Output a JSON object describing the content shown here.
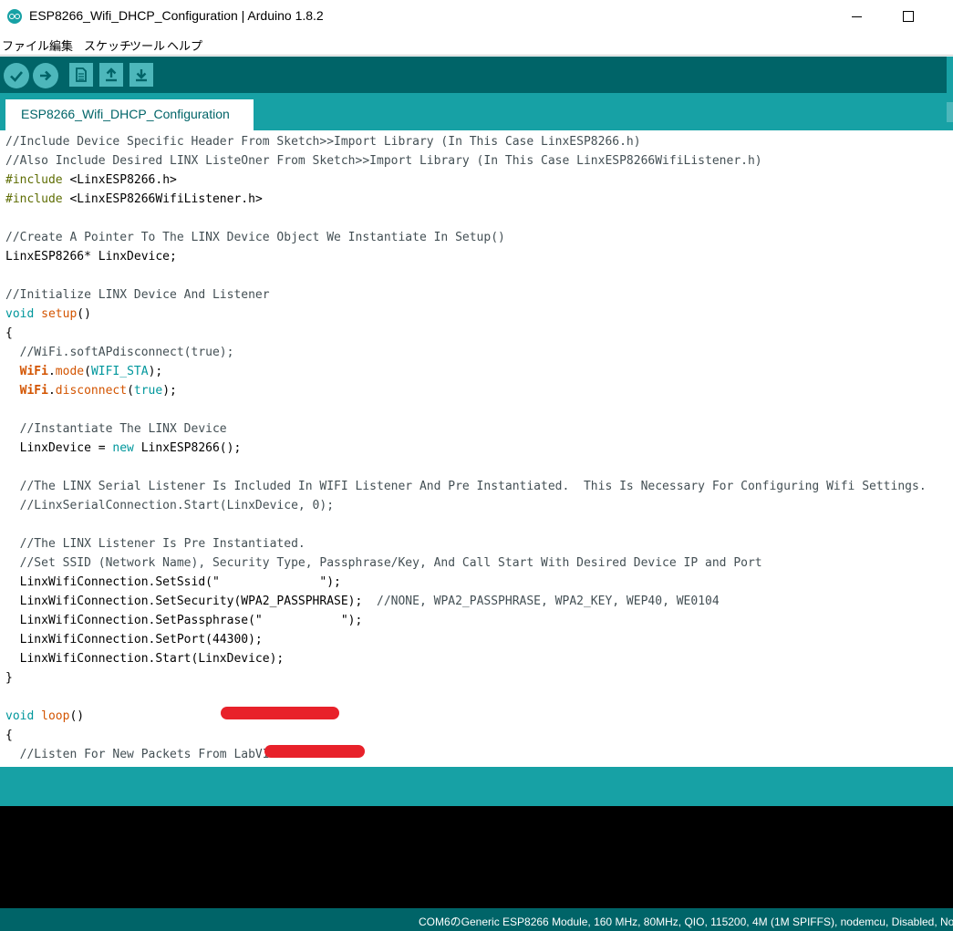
{
  "window": {
    "title": "ESP8266_Wifi_DHCP_Configuration | Arduino 1.8.2"
  },
  "menu": {
    "items": [
      "ファイル",
      "編集",
      "スケッチ",
      "ツール",
      "ヘルプ"
    ]
  },
  "toolbar": {
    "buttons": [
      "verify-icon",
      "upload-icon",
      "new-icon",
      "open-icon",
      "save-icon"
    ]
  },
  "tabs": [
    {
      "label": "ESP8266_Wifi_DHCP_Configuration"
    }
  ],
  "code": {
    "lines": [
      "//Include Device Specific Header From Sketch>>Import Library (In This Case LinxESP8266.h)",
      "//Also Include Desired LINX ListeOner From Sketch>>Import Library (In This Case LinxESP8266WifiListener.h)",
      "#include <LinxESP8266.h>",
      "#include <LinxESP8266WifiListener.h>",
      "",
      "//Create A Pointer To The LINX Device Object We Instantiate In Setup()",
      "LinxESP8266* LinxDevice;",
      "",
      "//Initialize LINX Device And Listener",
      "void setup()",
      "{",
      "  //WiFi.softAPdisconnect(true);",
      "  WiFi.mode(WIFI_STA);",
      "  WiFi.disconnect(true);",
      "",
      "  //Instantiate The LINX Device",
      "  LinxDevice = new LinxESP8266();",
      "",
      "  //The LINX Serial Listener Is Included In WIFI Listener And Pre Instantiated.  This Is Necessary For Configuring Wifi Settings.",
      "  //LinxSerialConnection.Start(LinxDevice, 0);",
      "",
      "  //The LINX Listener Is Pre Instantiated.",
      "  //Set SSID (Network Name), Security Type, Passphrase/Key, And Call Start With Desired Device IP and Port",
      "  LinxWifiConnection.SetSsid(\"              \");",
      "  LinxWifiConnection.SetSecurity(WPA2_PASSPHRASE);  //NONE, WPA2_PASSPHRASE, WPA2_KEY, WEP40, WE0104",
      "  LinxWifiConnection.SetPassphrase(\"           \");",
      "  LinxWifiConnection.SetPort(44300);",
      "  LinxWifiConnection.Start(LinxDevice);",
      "}",
      "",
      "void loop()",
      "{",
      "  //Listen For New Packets From LabVIEW"
    ]
  },
  "status": {
    "board_info": "COM6のGeneric ESP8266 Module, 160 MHz, 80MHz, QIO, 115200, 4M (1M SPIFFS), nodemcu, Disabled, No"
  },
  "colors": {
    "teal_dark": "#006468",
    "teal": "#17a1a5",
    "button": "#4db7bb",
    "redaction": "#e8212a"
  }
}
